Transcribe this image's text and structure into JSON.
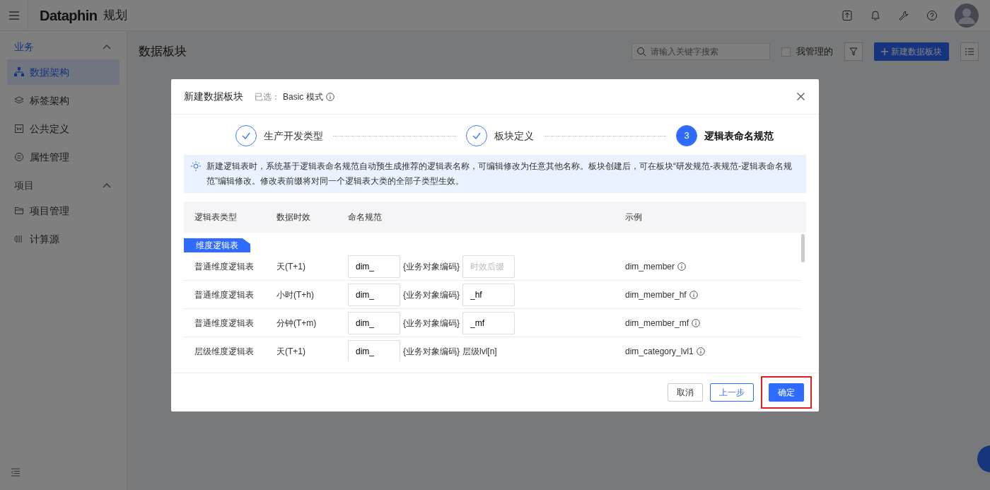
{
  "topbar": {
    "brand": "Dataphin",
    "module": "规划"
  },
  "sidebar": {
    "groups": [
      {
        "label": "业务",
        "active": true,
        "expanded": true,
        "items": [
          {
            "label": "数据架构",
            "kind": "hierarchy",
            "selected": true
          },
          {
            "label": "标签架构",
            "kind": "layers",
            "selected": false
          },
          {
            "label": "公共定义",
            "kind": "doc",
            "selected": false
          },
          {
            "label": "属性管理",
            "kind": "circle",
            "selected": false
          }
        ]
      },
      {
        "label": "项目",
        "active": false,
        "expanded": true,
        "items": [
          {
            "label": "项目管理",
            "kind": "folder",
            "selected": false
          },
          {
            "label": "计算源",
            "kind": "bars",
            "selected": false
          }
        ]
      }
    ]
  },
  "page": {
    "title": "数据板块",
    "search": {
      "placeholder": "请输入关键字搜索"
    },
    "mine": {
      "label": "我管理的",
      "checked": false
    },
    "new_button": "新建数据板块"
  },
  "modal": {
    "title": "新建数据板块",
    "selected_label": "已选：",
    "selected_value": "Basic 模式",
    "steps": [
      {
        "label": "生产开发类型",
        "completed": true,
        "selected": false
      },
      {
        "label": "板块定义",
        "completed": true,
        "selected": false
      },
      {
        "label": "逻辑表命名规范",
        "completed": false,
        "selected": true,
        "number": "3"
      }
    ],
    "alert": "新建逻辑表时，系统基于逻辑表命名规范自动预生成推荐的逻辑表名称，可编辑修改为任意其他名称。板块创建后，可在板块“研发规范-表规范-逻辑表命名规范”编辑修改。修改表前缀将对同一个逻辑表大类的全部子类型生效。",
    "table": {
      "columns": [
        "逻辑表类型",
        "数据时效",
        "命名规范",
        "示例"
      ],
      "group_tag": "维度逻辑表",
      "rows": [
        {
          "type": "普通维度逻辑表",
          "timeliness": "天(T+1)",
          "prefix": "dim_",
          "code": "{业务对象编码}",
          "suffix": {
            "kind": "input",
            "placeholder": "时效后缀"
          },
          "example": "dim_member"
        },
        {
          "type": "普通维度逻辑表",
          "timeliness": "小时(T+h)",
          "prefix": "dim_",
          "code": "{业务对象编码}",
          "suffix": {
            "kind": "input",
            "value": "_hf"
          },
          "example": "dim_member_hf"
        },
        {
          "type": "普通维度逻辑表",
          "timeliness": "分钟(T+m)",
          "prefix": "dim_",
          "code": "{业务对象编码}",
          "suffix": {
            "kind": "input",
            "value": "_mf"
          },
          "example": "dim_member_mf"
        },
        {
          "type": "层级维度逻辑表",
          "timeliness": "天(T+1)",
          "prefix": "dim_",
          "code": "{业务对象编码}",
          "suffix": {
            "kind": "text",
            "value": "层级lvl[n]"
          },
          "example": "dim_category_lvl1"
        }
      ]
    },
    "buttons": [
      {
        "label": "取消",
        "kind": "default",
        "highlighted": false
      },
      {
        "label": "上一步",
        "kind": "outline",
        "highlighted": false
      },
      {
        "label": "确定",
        "kind": "primary",
        "highlighted": true
      }
    ]
  }
}
